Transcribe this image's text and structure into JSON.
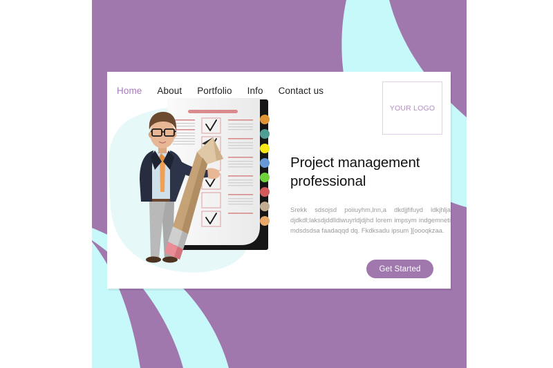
{
  "page": {
    "type": "landing-page-template",
    "background_color": "#a078ad",
    "accent_cyan": "#c8f9fa",
    "card_color": "#ffffff"
  },
  "nav": {
    "items": [
      {
        "label": "Home",
        "active": true
      },
      {
        "label": "About",
        "active": false
      },
      {
        "label": "Portfolio",
        "active": false
      },
      {
        "label": "Info",
        "active": false
      },
      {
        "label": "Contact us",
        "active": false
      }
    ],
    "active_color": "#a978bd",
    "inactive_color": "#231f20"
  },
  "logo": {
    "text": "YOUR LOGO",
    "border_color": "#e2cfe9",
    "text_color": "#b48dc6"
  },
  "hero": {
    "headline": "Project management professional",
    "body": "Srekk  sdsojsd poiiuyhm,lnn,a dkdjjfifuyd ldkjhlja djdkdl;laksdjddlldiwuyrldjdjhd lorem impsym indgemneti  mdsdsdsa  faadaqqd  dq. Fkdksadu ipsum ][oooqkzaa.",
    "cta_label": "Get Started",
    "cta_color": "#a078ad",
    "headline_color": "#111111",
    "body_color": "#9a9a9a"
  },
  "illustration": {
    "name": "businessman-with-giant-pencil-and-checklist",
    "checklist": {
      "items": [
        {
          "checked": true
        },
        {
          "checked": true
        },
        {
          "checked": false
        },
        {
          "checked": true
        },
        {
          "checked": false
        },
        {
          "checked": true
        }
      ],
      "check_glyph": "✓",
      "tab_colors": [
        "#e09436",
        "#4e9e94",
        "#f5e519",
        "#6699d8",
        "#6fd23b",
        "#d35a5a",
        "#c2ac90",
        "#e9a86a"
      ],
      "paper_color": "#f4f4f5",
      "spine_color": "#161616",
      "rule_accent": "#d98a8c"
    },
    "character": {
      "suit_color": "#272c3e",
      "shirt_color": "#cfe0ea",
      "tie_color": "#f0a055",
      "trousers_color": "#b9b9b9",
      "skin_color": "#e8b795",
      "hair_color": "#6b4a30",
      "shoe_color": "#4d3322"
    },
    "pencil": {
      "body_color": "#c6a277",
      "ferrule_color": "#cfcfcf",
      "eraser_color": "#e98c95",
      "tip_color": "#2b2b2b"
    },
    "blob_color": "#e6f8f8"
  }
}
